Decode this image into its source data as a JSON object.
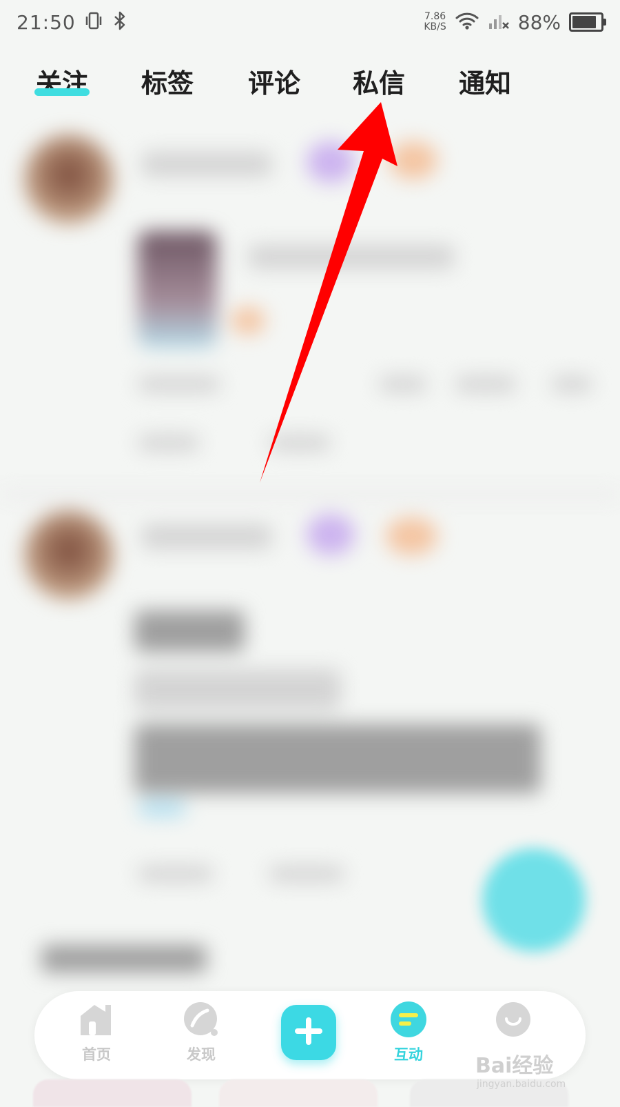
{
  "status_bar": {
    "time": "21:50",
    "net_speed_value": "7.86",
    "net_speed_unit": "KB/S",
    "battery_percent": "88%",
    "icons": [
      "vibrate-icon",
      "bluetooth-icon",
      "wifi-icon",
      "signal-icon",
      "battery-icon"
    ]
  },
  "tabs": [
    {
      "label": "关注",
      "active": true
    },
    {
      "label": "标签",
      "active": false
    },
    {
      "label": "评论",
      "active": false
    },
    {
      "label": "私信",
      "active": false
    },
    {
      "label": "通知",
      "active": false
    }
  ],
  "bottom_nav": {
    "items": [
      {
        "label": "首页",
        "icon": "home-icon",
        "active": false
      },
      {
        "label": "发现",
        "icon": "discover-icon",
        "active": false
      },
      {
        "label": "",
        "icon": "plus-icon",
        "active": false
      },
      {
        "label": "互动",
        "icon": "interact-icon",
        "active": true
      },
      {
        "label": "",
        "icon": "smile-icon",
        "active": false
      }
    ]
  },
  "watermark": {
    "main": "Bai经验",
    "sub": "jingyan.baidu.com"
  },
  "colors": {
    "accent": "#3fdde0",
    "annotation": "#ff0000",
    "inactive": "#c8c8c8"
  }
}
